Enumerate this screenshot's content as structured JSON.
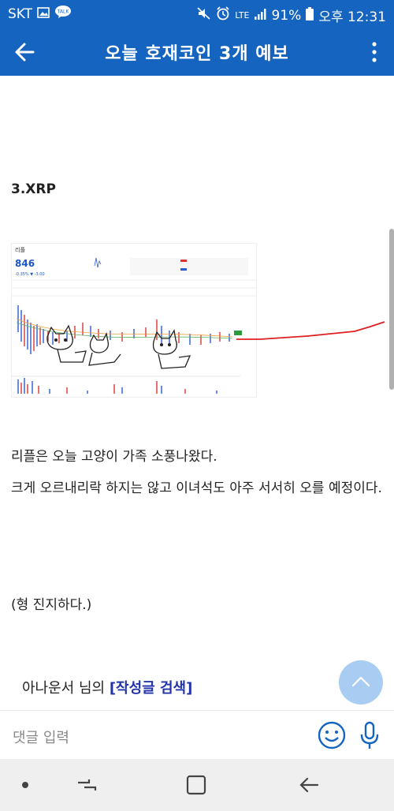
{
  "status_bar": {
    "carrier": "SKT",
    "icons_left": [
      "image-icon",
      "talk-icon"
    ],
    "talk_label": "TALK",
    "network": "LTE",
    "battery": "91%",
    "time": "오후 12:31"
  },
  "app_bar": {
    "title": "오늘 호재코인 3개 예보"
  },
  "post": {
    "heading": "3.XRP",
    "paragraph1": "리플은 오늘 고양이 가족 소풍나왔다.",
    "paragraph2": "크게 오르내리락 하지는 않고 이녀석도 아주 서서히 오를 예정이다.",
    "paragraph3": "(형 진지하다.)",
    "author_prefix": "아나운서 님의 ",
    "search_link": "[작성글 검색]",
    "chart_snapshot": {
      "name": "리플",
      "price": "846",
      "change": "-0.35% ▼ -3.00"
    }
  },
  "comment_bar": {
    "placeholder": "댓글 입력"
  },
  "colors": {
    "primary": "#1565c0",
    "fab": "#a9cdf2",
    "link": "#2233aa",
    "forecast_line": "#e02020"
  }
}
